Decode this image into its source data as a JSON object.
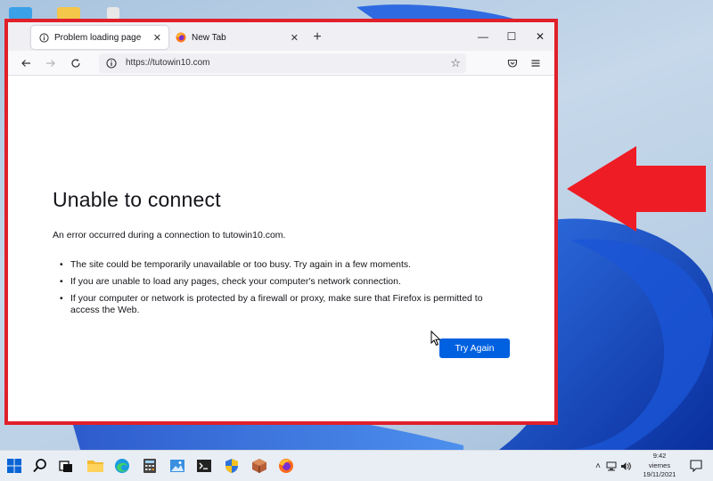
{
  "browser": {
    "tabs": [
      {
        "label": "Problem loading page",
        "active": true
      },
      {
        "label": "New Tab",
        "active": false
      }
    ],
    "url": "https://tutowin10.com"
  },
  "error_page": {
    "title": "Unable to connect",
    "description": "An error occurred during a connection to tutowin10.com.",
    "bullets": [
      "The site could be temporarily unavailable or too busy. Try again in a few moments.",
      "If you are unable to load any pages, check your computer's network connection.",
      "If your computer or network is protected by a firewall or proxy, make sure that Firefox is permitted to access the Web."
    ],
    "try_again_label": "Try Again"
  },
  "taskbar": {
    "clock": {
      "time": "9:42",
      "day": "viernes",
      "date": "19/11/2021"
    }
  },
  "colors": {
    "highlight": "#e0202a",
    "button_primary": "#0061e0"
  }
}
